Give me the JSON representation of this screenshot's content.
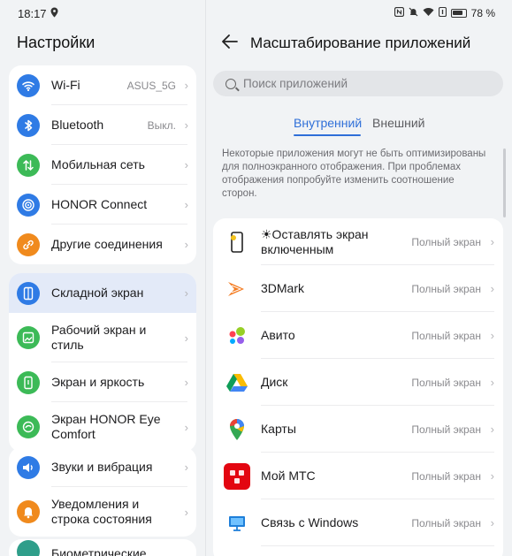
{
  "status": {
    "time": "18:17",
    "battery": "78 %"
  },
  "settings": {
    "title": "Настройки",
    "groups": [
      [
        {
          "label": "Wi-Fi",
          "value": "ASUS_5G",
          "icon": "wifi-icon",
          "color": "#2f7be5"
        },
        {
          "label": "Bluetooth",
          "value": "Выкл.",
          "icon": "bluetooth-icon",
          "color": "#2f7be5"
        },
        {
          "label": "Мобильная сеть",
          "value": "",
          "icon": "mobile-data-icon",
          "color": "#3cba57"
        },
        {
          "label": "HONOR Connect",
          "value": "",
          "icon": "honor-connect-icon",
          "color": "#2f7be5"
        },
        {
          "label": "Другие соединения",
          "value": "",
          "icon": "link-icon",
          "color": "#f08a1d"
        }
      ],
      [
        {
          "label": "Складной экран",
          "value": "",
          "icon": "foldable-screen-icon",
          "color": "#2f7be5"
        },
        {
          "label": "Рабочий экран и стиль",
          "value": "",
          "icon": "home-screen-icon",
          "color": "#3cba57"
        },
        {
          "label": "Экран и яркость",
          "value": "",
          "icon": "display-icon",
          "color": "#3cba57"
        },
        {
          "label": "Экран HONOR Eye Comfort",
          "value": "",
          "icon": "eye-comfort-icon",
          "color": "#3cba57"
        }
      ],
      [
        {
          "label": "Звуки и вибрация",
          "value": "",
          "icon": "sound-icon",
          "color": "#2f7be5"
        },
        {
          "label": "Уведомления и строка состояния",
          "value": "",
          "icon": "notification-icon",
          "color": "#f08a1d"
        }
      ],
      [
        {
          "label": "Биометрические",
          "value": "",
          "icon": "biometrics-icon",
          "color": "#2f9e8a"
        }
      ]
    ]
  },
  "scaling": {
    "title": "Масштабирование приложений",
    "search_placeholder": "Поиск приложений",
    "tab_internal": "Внутренний",
    "tab_external": "Внешний",
    "notice": "Некоторые приложения могут не быть оптимизированы для полноэкранного отображения. При проблемах отображения попробуйте изменить соотношение сторон.",
    "apps": [
      {
        "name": "☀Оставлять экран включенным",
        "mode": "Полный экран",
        "icon": "keep-screen-on-icon"
      },
      {
        "name": "3DMark",
        "mode": "Полный экран",
        "icon": "3dmark-icon"
      },
      {
        "name": "Авито",
        "mode": "Полный экран",
        "icon": "avito-icon"
      },
      {
        "name": "Диск",
        "mode": "Полный экран",
        "icon": "google-drive-icon"
      },
      {
        "name": "Карты",
        "mode": "Полный экран",
        "icon": "google-maps-icon"
      },
      {
        "name": "Мой МТС",
        "mode": "Полный экран",
        "icon": "mts-icon"
      },
      {
        "name": "Связь с Windows",
        "mode": "Полный экран",
        "icon": "link-to-windows-icon"
      }
    ]
  }
}
